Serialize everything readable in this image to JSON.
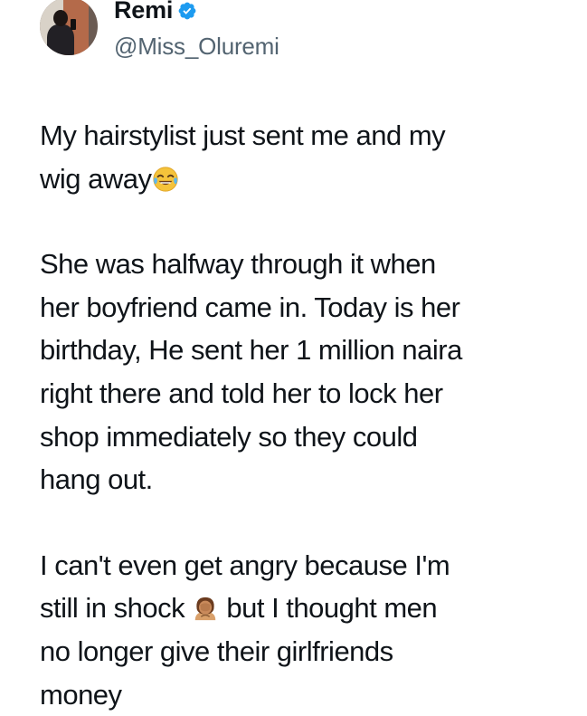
{
  "user": {
    "display_name": "Remi",
    "handle": "@Miss_Oluremi",
    "verified": true,
    "verified_color": "#1d9bf0"
  },
  "tweet": {
    "para1_line1": "My hairstylist just sent me and my",
    "para1_line2": "wig away",
    "para1_emoji": "face-with-tears-of-joy-icon",
    "para2_line1": "She was halfway through it when",
    "para2_line2": "her boyfriend came in. Today is her",
    "para2_line3": "birthday, He sent her 1 million naira",
    "para2_line4": "right there and told her to lock her",
    "para2_line5": "shop immediately so they could",
    "para2_line6": "hang out.",
    "para3_line1": "I can't even get angry because I'm",
    "para3_line2a": "still in shock",
    "para3_emoji": "woman-facepalming-icon",
    "para3_line2b": "but I thought men",
    "para3_line3": "no longer give their girlfriends",
    "para3_line4": "money"
  },
  "colors": {
    "text": "#0f1419",
    "secondary_text": "#536471",
    "background": "#ffffff"
  }
}
